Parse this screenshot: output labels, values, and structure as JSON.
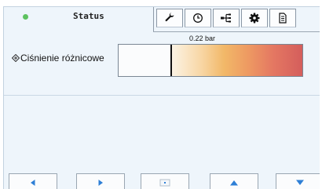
{
  "tab_bar": {
    "status_title": "Status",
    "status_indicator_color": "#5dc260",
    "tabs": [
      {
        "icon": "wrench-icon"
      },
      {
        "icon": "clock-icon"
      },
      {
        "icon": "network-tree-icon"
      },
      {
        "icon": "gear-icon"
      },
      {
        "icon": "document-icon"
      }
    ]
  },
  "parameter": {
    "label": "Ciśnienie różnicowe",
    "label_icon": "diamond-icon",
    "value_text": "0.22 bar",
    "gauge_level": 0.28,
    "gauge_colors": [
      "#fbf3e4",
      "#f2b868",
      "#d45e5c"
    ]
  },
  "nav": [
    {
      "icon": "arrow-left-icon"
    },
    {
      "icon": "arrow-right-icon"
    },
    {
      "icon": "home-square-icon"
    },
    {
      "icon": "arrow-up-icon"
    },
    {
      "icon": "arrow-down-icon"
    }
  ]
}
